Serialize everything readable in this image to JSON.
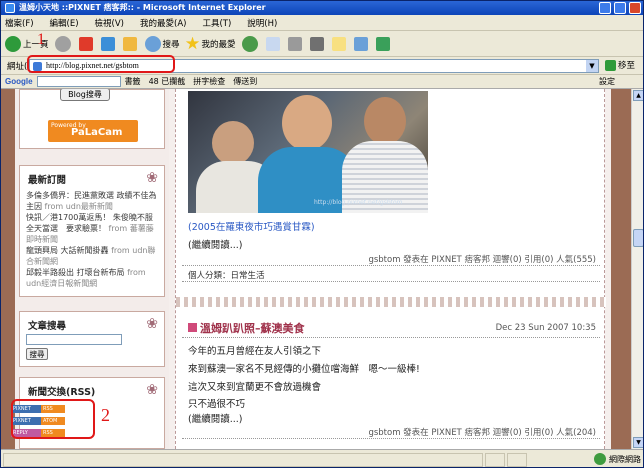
{
  "window": {
    "title": "溫姆小天地 ::PIXNET 痞客邦:: - Microsoft Internet Explorer"
  },
  "menu": [
    "檔案(F)",
    "編輯(E)",
    "檢視(V)",
    "我的最愛(A)",
    "工具(T)",
    "說明(H)"
  ],
  "toolbar": {
    "back_label": "上一頁",
    "search_label": "搜尋",
    "favorites_label": "我的最愛"
  },
  "address": {
    "label": "網址(D)",
    "url": "http://blog.pixnet.net/gsbtom",
    "go_label": "移至"
  },
  "annotations": {
    "one": "1",
    "two": "2"
  },
  "googlebar": {
    "logo": "Google",
    "bookmarks": "書籤",
    "blocked": "48 已攔截",
    "spell": "拼字檢查",
    "send": "傳送到",
    "settings": "設定"
  },
  "sidebar": {
    "button_label": "Blog搜尋",
    "powered": "Powered by",
    "brand": "PaLaCam",
    "latest_title": "最新訂閱",
    "feeds": [
      {
        "text": "多倫多僑界：民進黨敗選 政績不佳為主因",
        "from": " from udn最新新聞"
      },
      {
        "text": "快訊／港1700萬返馬！ 朱俊曉不服全天當選　要求驗票！",
        "from": " from 蕃薯藤即時新聞"
      },
      {
        "text": "龍頭興局 大話新聞掛轟",
        "from": " from udn聯合新聞網"
      },
      {
        "text": "邱毅半路殺出 打壞台新布局",
        "from": " from udn經濟日報新聞網"
      }
    ],
    "search_title": "文章搜尋",
    "search_button": "搜尋",
    "rss_title": "新聞交換(RSS)",
    "rss_buttons": [
      {
        "left": "PIXNET",
        "right": "RSS"
      },
      {
        "left": "PIXNET",
        "right": "ATOM"
      },
      {
        "left": "REPLY",
        "right": "RSS"
      }
    ]
  },
  "post1": {
    "caption": "(2005在羅東夜市巧遇賞甘霖)",
    "more": "(繼續閱讀...)",
    "meta": "gsbtom 發表在 PIXNET 痞客邦 迴響(0) 引用(0) 人氣(555)",
    "category": "個人分類：日常生活",
    "watermark": "http://blog.pixnet.net/gsbtom"
  },
  "post2": {
    "title": "溫姆趴趴照–蘇澳美食",
    "date": "Dec 23 Sun 2007 10:35",
    "lines": [
      "今年的五月曾經在友人引領之下",
      "來到蘇澳一家名不見經傳的小攤位嚐海鮮　嗯～一級棒!",
      "這次又來到宜蘭更不會放過機會",
      "只不過很不巧"
    ],
    "more": "(繼續閱讀...)",
    "meta": "gsbtom 發表在 PIXNET 痞客邦 迴響(0) 引用(0) 人氣(204)"
  },
  "status": {
    "zone": "網際網路"
  }
}
